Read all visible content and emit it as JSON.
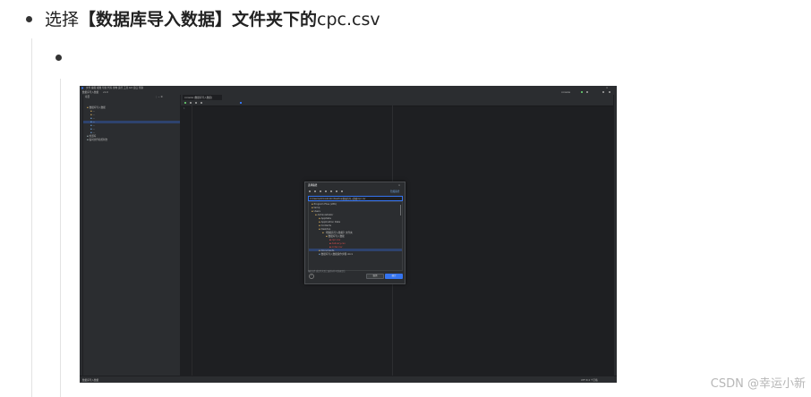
{
  "doc": {
    "step_prefix": "选择",
    "step_bold": "【数据库导入数据】文件夹下的",
    "step_suffix": "cpc.csv",
    "watermark": "CSDN @幸运小新"
  },
  "ide": {
    "menu": [
      "文件",
      "编辑",
      "视图",
      "导航",
      "代码",
      "重构",
      "运行",
      "工具",
      "Git",
      "窗口",
      "帮助"
    ],
    "project_label": "数据库导入数据",
    "nav_branch": "v1.0",
    "project_panel_title": "项目",
    "tree": [
      "数据库导入数据",
      "外部库",
      "临时文件和控制台"
    ],
    "editor_tab": "console [数据库导入数据]",
    "run_config": "console",
    "dialog": {
      "title": "选择路径",
      "hide_path": "隐藏路径",
      "path": "C:\\Users\\Administrator\\Desktop\\数据库导入数据\\cpc.csv",
      "items": [
        "Program Files (x86)",
        "temp",
        "Users",
        "Administrator",
        "AppData",
        "Application Data",
        "Contacts",
        "Desktop",
        "【数据库导入数据】文件夹",
        "数据库导入数据",
        "cpc.csv",
        "delivery.csv",
        "order.csv",
        "Documents",
        "数据库导入数据操作步骤.docx"
      ],
      "hint": "拖放文件或文件夹到上面的树中可快速定位",
      "cancel": "取消",
      "ok": "确定",
      "help": "?"
    },
    "status_left": "数据库导入数据",
    "status_right": "UTF-8   4 个空格"
  },
  "colors": {
    "accent": "#3574f0",
    "ide_bg": "#2b2d30",
    "editor_bg": "#1e1f22",
    "csv_icon": "#d84c4c",
    "folder_icon": "#c7a25a"
  }
}
